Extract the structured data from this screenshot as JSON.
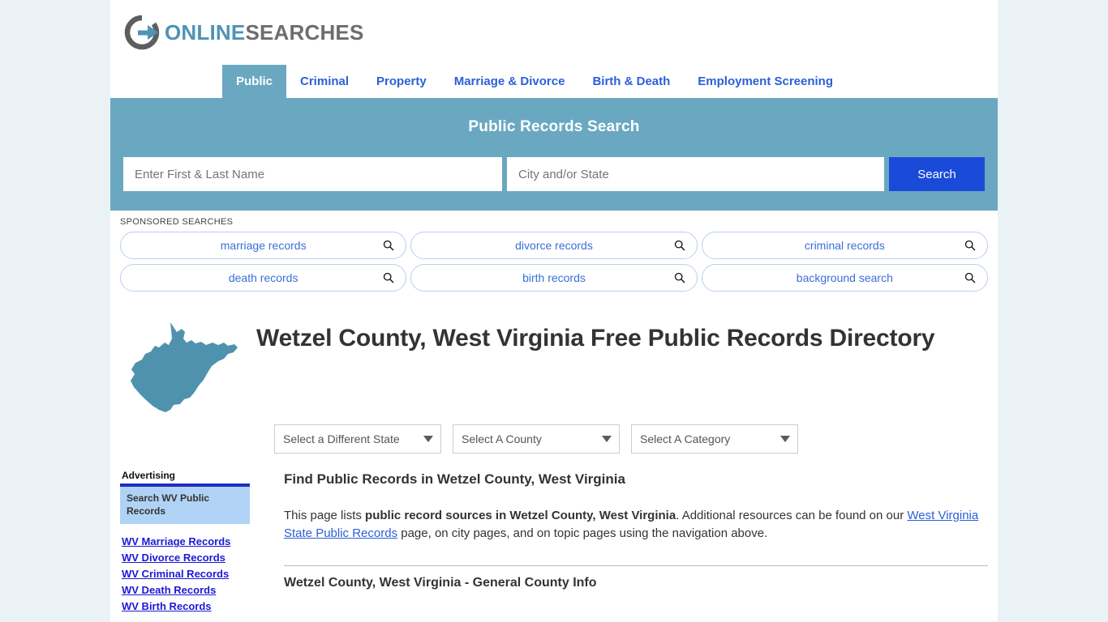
{
  "site": {
    "logo_text_1": "ONLINE",
    "logo_text_2": "SEARCHES",
    "logo_icon": "circle-arrow-icon"
  },
  "nav": {
    "tabs": [
      {
        "label": "Public",
        "active": true
      },
      {
        "label": "Criminal",
        "active": false
      },
      {
        "label": "Property",
        "active": false
      },
      {
        "label": "Marriage & Divorce",
        "active": false
      },
      {
        "label": "Birth & Death",
        "active": false
      },
      {
        "label": "Employment Screening",
        "active": false
      }
    ]
  },
  "banner": {
    "title": "Public Records Search",
    "name_placeholder": "Enter First & Last Name",
    "name_value": "",
    "city_placeholder": "City and/or State",
    "city_value": "",
    "search_button": "Search",
    "bg_color": "#6aa8c2",
    "button_color": "#1a4bd8"
  },
  "sponsored": {
    "label": "SPONSORED SEARCHES",
    "row1": [
      {
        "text": "marriage records",
        "icon": "search-icon"
      },
      {
        "text": "divorce records",
        "icon": "search-icon"
      },
      {
        "text": "criminal records",
        "icon": "search-icon"
      }
    ],
    "row2": [
      {
        "text": "death records",
        "icon": "search-icon"
      },
      {
        "text": "birth records",
        "icon": "search-icon"
      },
      {
        "text": "background search",
        "icon": "search-icon"
      }
    ]
  },
  "hero": {
    "map_icon": "west-virginia-state-map",
    "map_color": "#4f92ae",
    "title": "Wetzel County, West Virginia Free Public Records Directory"
  },
  "selects": {
    "state": "Select a Different State",
    "county": "Select A County",
    "category": "Select A Category",
    "caret_icon": "chevron-down-icon"
  },
  "sidebar": {
    "advertising_label": "Advertising",
    "ad_box_text": "Search WV Public Records",
    "links": [
      "WV Marriage Records",
      "WV Divorce Records",
      "WV Criminal Records",
      "WV Death Records",
      "WV Birth Records"
    ]
  },
  "main": {
    "heading": "Find Public Records in Wetzel County, West Virginia",
    "para_1": "This page lists ",
    "para_bold": "public record sources in Wetzel County, West Virginia",
    "para_2": ". Additional resources can be found on our ",
    "para_link": "West Virginia State Public Records",
    "para_3": " page, on city pages, and on topic pages using the navigation above.",
    "subheading": "Wetzel County, West Virginia - General County Info"
  }
}
